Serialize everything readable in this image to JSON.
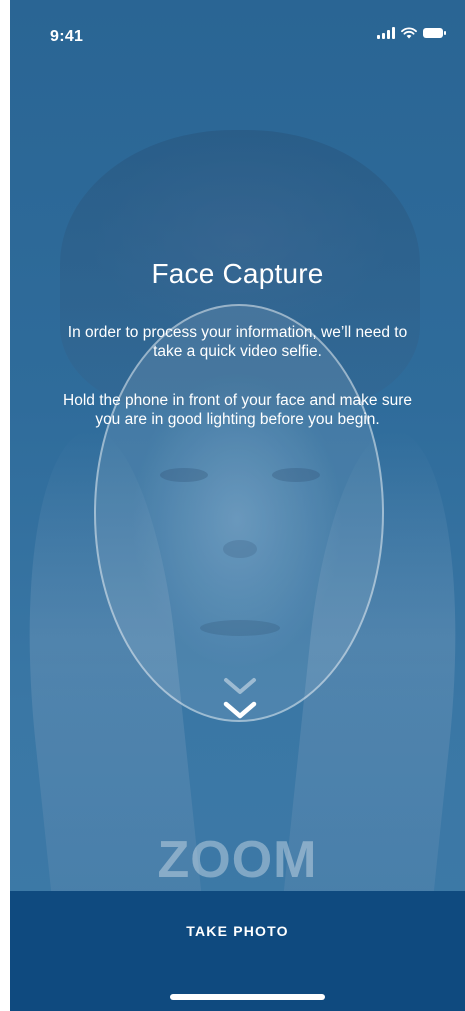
{
  "status_bar": {
    "time": "9:41",
    "icons": [
      "signal-icon",
      "wifi-icon",
      "battery-icon"
    ]
  },
  "capture": {
    "title": "Face Capture",
    "intro": "In order to process your information, we’ll need to take a quick video selfie.",
    "instructions": "Hold the phone in front of your face and make sure you are in good lighting before you begin.",
    "guide_icons": [
      "chevron-down-icon",
      "chevron-down-icon"
    ]
  },
  "brand": {
    "logo_text": "ZOOM"
  },
  "action": {
    "take_photo_label": "TAKE PHOTO"
  },
  "colors": {
    "overlay": "#2d6896",
    "action_bar": "#0f4a7f",
    "text": "#ffffff"
  }
}
